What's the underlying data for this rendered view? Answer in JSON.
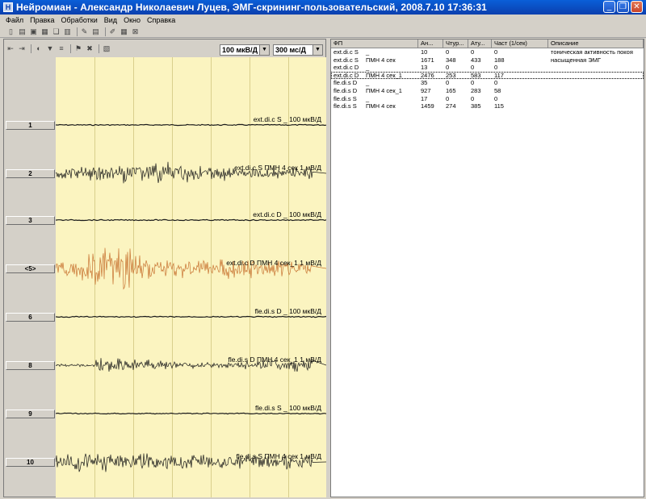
{
  "window": {
    "title": "Нейромиан - Александр Николаевич Луцев, ЭМГ-скрининг-пользовательский, 2008.7.10 17:36:31",
    "app_icon": "neuromian-app-icon",
    "controls": [
      "minimize-icon",
      "restore-icon",
      "close-icon"
    ]
  },
  "menu": [
    "Файл",
    "Правка",
    "Обработки",
    "Вид",
    "Окно",
    "Справка"
  ],
  "left_toolbar": {
    "amplitude": "100 мкВ/Д",
    "sweep": "300 мс/Д"
  },
  "channels": [
    {
      "button": "1",
      "label": "ext.di.c S  _  100 мкВ/Д",
      "signal": "flat",
      "color": "#1a1a1a"
    },
    {
      "button": "2",
      "label": "ext.di.c S  ПМН 4 сек  1 мВ/Д",
      "signal": "burst",
      "color": "#1a1a1a"
    },
    {
      "button": "3",
      "label": "ext.di.c D  _  100 мкВ/Д",
      "signal": "flat",
      "color": "#1a1a1a"
    },
    {
      "button": "<5>",
      "label": "ext.di.c D  ПМН 4 сек_1  1 мВ/Д",
      "signal": "burst",
      "color": "#c87432"
    },
    {
      "button": "6",
      "label": "fle.di.s D  _  100 мкВ/Д",
      "signal": "flat",
      "color": "#1a1a1a"
    },
    {
      "button": "8",
      "label": "fle.di.s D  ПМН 4 сек_1  1 мВ/Д",
      "signal": "burst",
      "color": "#1a1a1a"
    },
    {
      "button": "9",
      "label": "fle.di.s S  _  100 мкВ/Д",
      "signal": "flat",
      "color": "#1a1a1a"
    },
    {
      "button": "10",
      "label": "fle.di.s S  ПМН 4 сек  1 мВ/Д",
      "signal": "burst",
      "color": "#1a1a1a"
    }
  ],
  "table": {
    "columns": [
      "ФП",
      "Ан...",
      "Чтур...",
      "Ату...",
      "Част (1/сек)",
      "Описание"
    ],
    "rows": [
      {
        "name": "ext.di.c S",
        "sub": "_",
        "a": "10",
        "b": "0",
        "c": "0",
        "d": "0",
        "desc": "тоническая активность покоя"
      },
      {
        "name": "ext.di.c S",
        "sub": "ПМН 4 сек",
        "a": "1671",
        "b": "348",
        "c": "433",
        "d": "188",
        "desc": "насыщенная ЭМГ"
      },
      {
        "name": "ext.di.c D",
        "sub": "_",
        "a": "13",
        "b": "0",
        "c": "0",
        "d": "0",
        "desc": ""
      },
      {
        "name": "ext.di.c D",
        "sub": "ПМН 4 сек_1",
        "a": "2476",
        "b": "253",
        "c": "583",
        "d": "117",
        "desc": ""
      },
      {
        "name": "fle.di.s D",
        "sub": "_",
        "a": "35",
        "b": "0",
        "c": "0",
        "d": "0",
        "desc": ""
      },
      {
        "name": "fle.di.s D",
        "sub": "ПМН 4 сек_1",
        "a": "927",
        "b": "165",
        "c": "283",
        "d": "58",
        "desc": ""
      },
      {
        "name": "fle.di.s S",
        "sub": "_",
        "a": "17",
        "b": "0",
        "c": "0",
        "d": "0",
        "desc": ""
      },
      {
        "name": "fle.di.s S",
        "sub": "ПМН 4 сек",
        "a": "1459",
        "b": "274",
        "c": "385",
        "d": "115",
        "desc": ""
      }
    ],
    "selected_index": 3
  }
}
